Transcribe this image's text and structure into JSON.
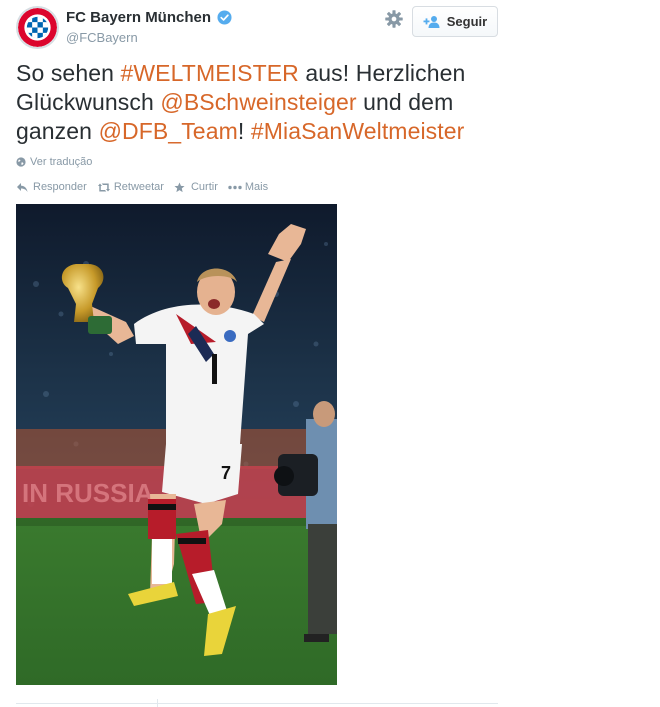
{
  "account": {
    "display_name": "FC Bayern München",
    "handle": "@FCBayern",
    "verified": true,
    "avatar_icon": "fc-bayern-crest-icon",
    "avatar_text": "FC BAYERN MÜNCHEN"
  },
  "header": {
    "follow_label": "Seguir",
    "settings_icon": "gear-icon"
  },
  "tweet": {
    "segments": [
      {
        "text": "So sehen ",
        "link": false
      },
      {
        "text": "#WELTMEISTER",
        "link": true
      },
      {
        "text": " aus! Herzlichen Glückwunsch ",
        "link": false
      },
      {
        "text": "@BSchweinsteiger",
        "link": true
      },
      {
        "text": " und dem ganzen ",
        "link": false
      },
      {
        "text": "@DFB_Team",
        "link": true
      },
      {
        "text": "! ",
        "link": false
      },
      {
        "text": "#MiaSanWeltmeister",
        "link": true
      }
    ],
    "translate_label": "Ver tradução"
  },
  "actions": {
    "reply": "Responder",
    "retweet": "Retweetar",
    "favorite": "Curtir",
    "more": "Mais"
  },
  "media": {
    "jersey_number": "7"
  },
  "colors": {
    "link": "#d76729",
    "text": "#292f33",
    "muted": "#8899a6"
  }
}
